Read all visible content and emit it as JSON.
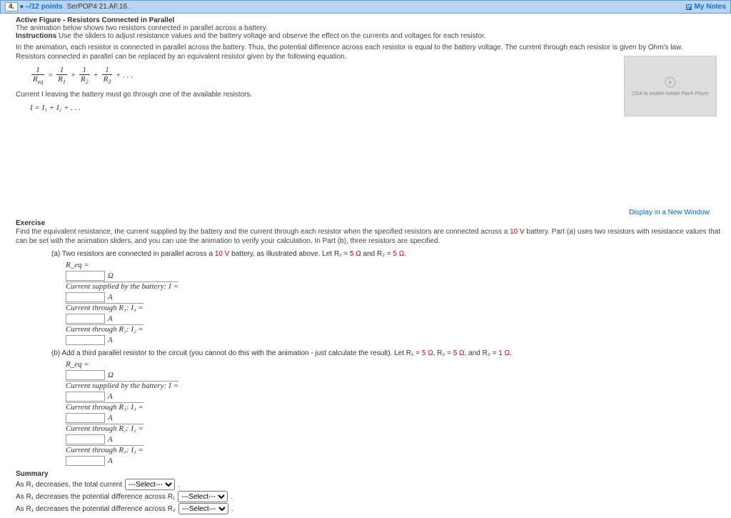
{
  "header": {
    "question_number": "4.",
    "points_prefix": "–/12 points",
    "book_ref": "SerPOP4 21.AF.16.",
    "my_notes": "My Notes"
  },
  "active_figure": {
    "title": "Active Figure - Resistors Connected in Parallel",
    "line1": "The animation below shows two resistors connected in parallel across a battery.",
    "instr_label": "Instructions",
    "instr_text": "Use the sliders to adjust resistance values and the battery voltage and observe the effect on the currents and voltages for each resistor.",
    "para1": "In the animation, each resistor is connected in parallel across the battery. Thus, the potential difference across each resistor is equal to the battery voltage. The current through each resistor is given by Ohm's law.",
    "para2": "Resistors connected in parallel can be replaced by an equivalent resistor given by the following equation.",
    "para3": "Current I leaving the battery must go through one of the available resistors.",
    "eq2_text": "I = I₁ + I₂ + . . .",
    "display_link": "Display in a New Window",
    "flash_text": "Click to enable Adobe Flash Player"
  },
  "exercise": {
    "label": "Exercise",
    "intro_a": "Find the equivalent resistance, the current supplied by the battery and the current through each resistor when the specified resistors are connected across a ",
    "volt": "10 V",
    "intro_b": " battery. Part (a) uses two resistors with resistance values that can be set with the animation sliders, and you can use the animation to verify your calculation. In Part (b), three resistors are specified.",
    "part_a": {
      "prefix": "(a) Two resistors are connected in parallel across a ",
      "mid": " battery, as illustrated above. Let R₁ = ",
      "r1": "5 Ω",
      "and": " and R₂ = ",
      "r2": "5 Ω."
    },
    "labels": {
      "req": "R_eq =",
      "ohm": "Ω",
      "isupp": "Current supplied by the battery: I =",
      "amp": "A",
      "i1": "Current through R₁:  I₁ =",
      "i2": "Current through R₂:  I₂ =",
      "i3": "Current through R₃:  I₃ ="
    },
    "part_b": {
      "text": "(b) Add a third parallel resistor to the circuit (you cannot do this with the animation - just calculate the result). Let R₁ = ",
      "r1": "5 Ω",
      "c1": ", R₂ = ",
      "r2": "5 Ω",
      "c2": ", and R₃ = ",
      "r3": "1 Ω."
    }
  },
  "summary": {
    "label": "Summary",
    "l1_a": "As R₁ decreases, the total current",
    "l2_a": "As R₁ decreases the potential difference across R₁",
    "l3_a": "As R₁ decreases the potential difference across R₂",
    "select_default": "---Select---",
    "period": "."
  }
}
